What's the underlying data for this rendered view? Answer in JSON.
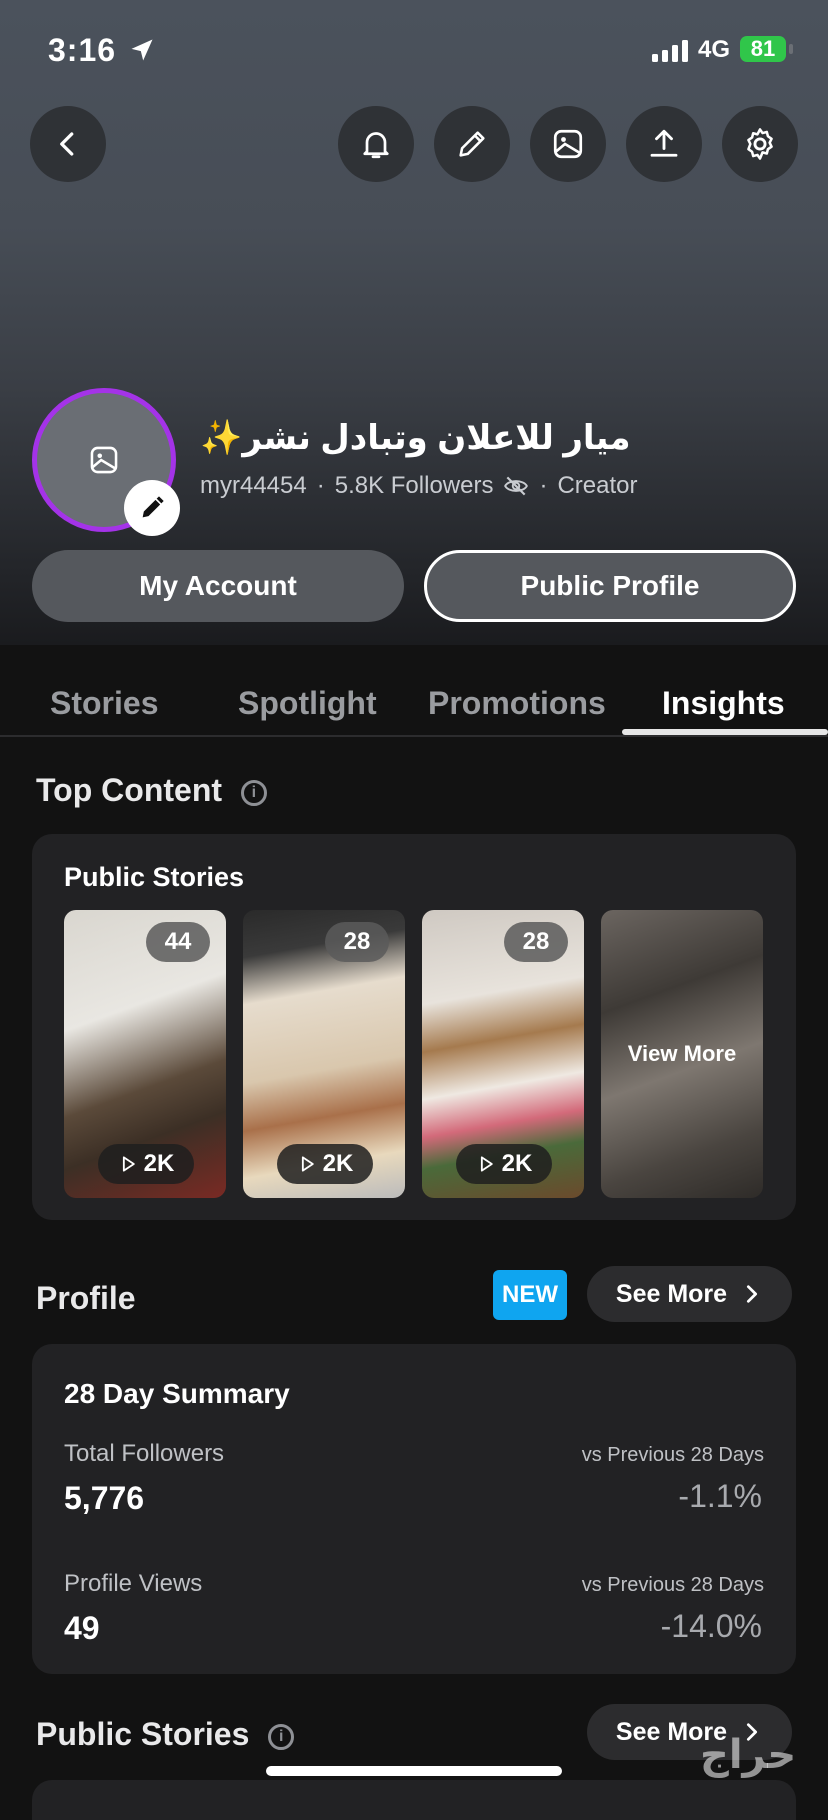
{
  "status_bar": {
    "time": "3:16",
    "network": "4G",
    "battery": "81"
  },
  "profile": {
    "name": "ميار للاعلان وتبادل نشر✨",
    "username": "myr44454",
    "followers": "5.8K Followers",
    "role": "Creator",
    "my_account_label": "My Account",
    "public_profile_label": "Public Profile"
  },
  "tabs": [
    "Stories",
    "Spotlight",
    "Promotions",
    "Insights"
  ],
  "top_content": {
    "title": "Top Content",
    "card_title": "Public Stories",
    "thumbs": [
      {
        "count": "44",
        "plays": "2K"
      },
      {
        "count": "28",
        "plays": "2K"
      },
      {
        "count": "28",
        "plays": "2K"
      }
    ],
    "view_more": "View More"
  },
  "profile_section": {
    "title": "Profile",
    "new_badge": "NEW",
    "see_more": "See More",
    "summary_title": "28 Day Summary",
    "metrics": [
      {
        "label": "Total Followers",
        "value": "5,776",
        "vs": "vs Previous 28 Days",
        "change": "-1.1%"
      },
      {
        "label": "Profile Views",
        "value": "49",
        "vs": "vs Previous 28 Days",
        "change": "-14.0%"
      }
    ]
  },
  "public_stories_section": {
    "title": "Public Stories",
    "see_more": "See More"
  },
  "watermark": "حراج"
}
